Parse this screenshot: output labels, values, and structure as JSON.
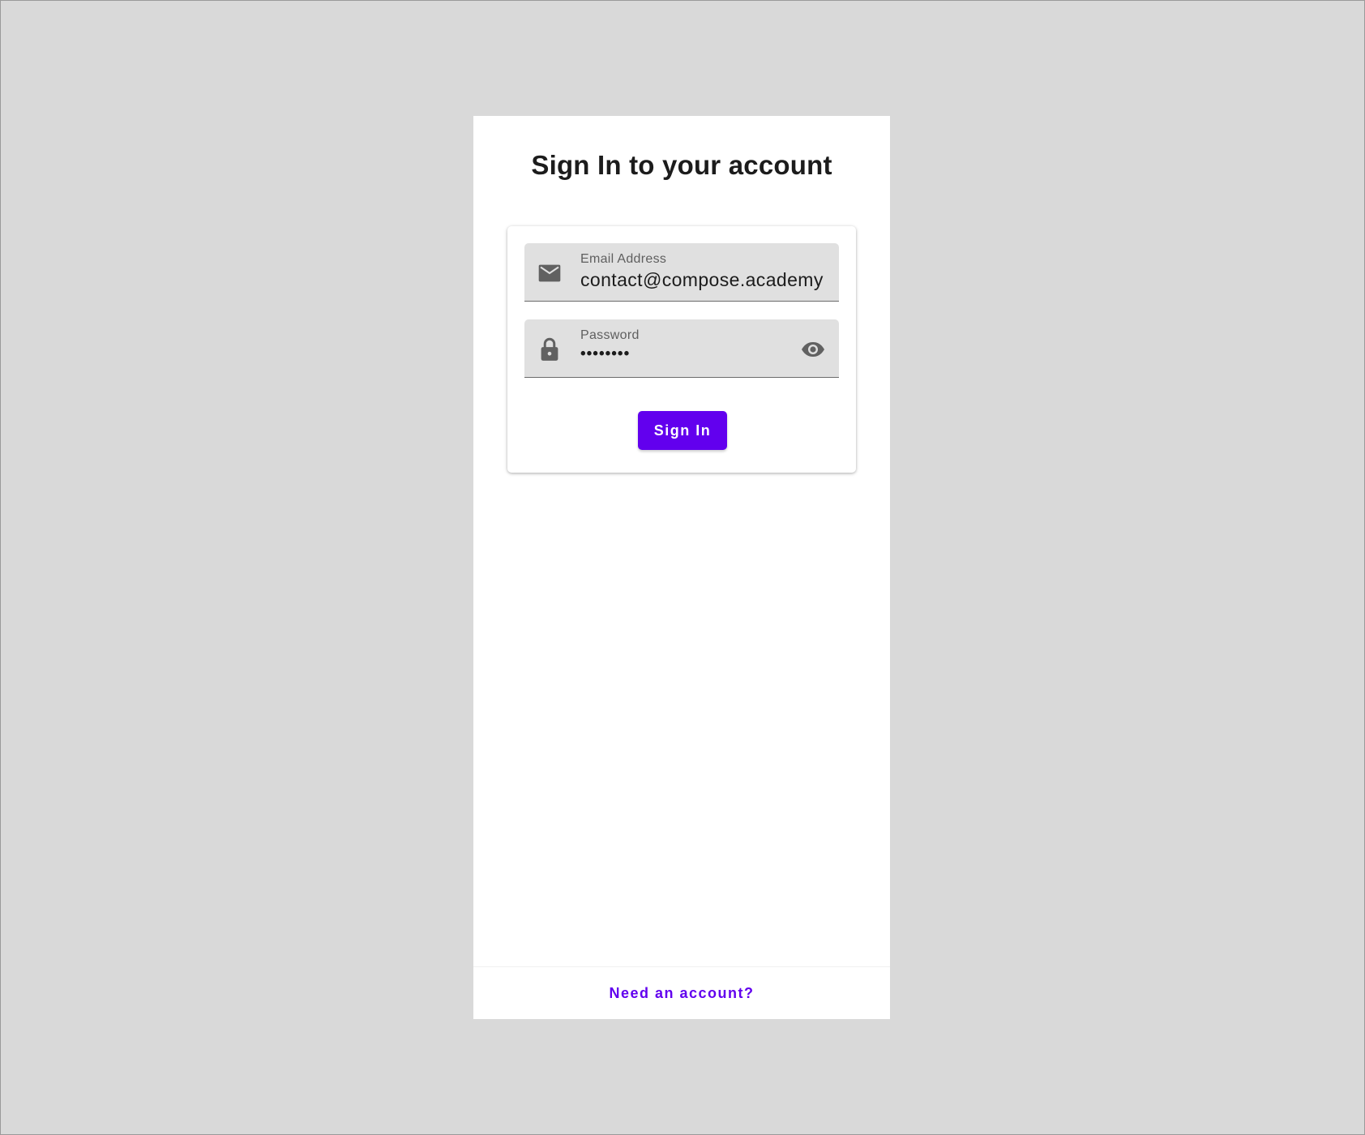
{
  "page": {
    "title": "Sign In to your account"
  },
  "form": {
    "email": {
      "label": "Email Address",
      "value": "contact@compose.academy",
      "icon": "envelope-icon"
    },
    "password": {
      "label": "Password",
      "value": "••••••••",
      "icon": "lock-icon",
      "toggle_icon": "eye-icon"
    },
    "submit_label": "Sign In"
  },
  "footer": {
    "link_label": "Need an account?"
  },
  "colors": {
    "accent": "#6200ee",
    "field_background": "#e0e0e0",
    "page_background": "#d9d9d9"
  }
}
